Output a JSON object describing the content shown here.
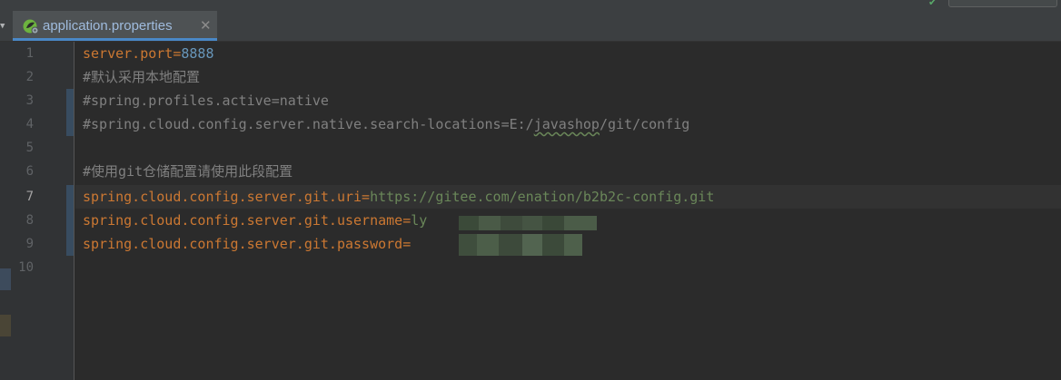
{
  "tab": {
    "label": "application.properties",
    "close_icon": "close-icon",
    "file_icon": "spring-properties-icon"
  },
  "gutter": {
    "line_numbers": [
      "1",
      "2",
      "3",
      "4",
      "5",
      "6",
      "7",
      "8",
      "9",
      "10"
    ],
    "current_line": "7"
  },
  "code": {
    "line1": {
      "key": "server.port",
      "eq": "=",
      "value": "8888"
    },
    "line2": {
      "comment": "#默认采用本地配置"
    },
    "line3": {
      "comment": "#spring.profiles.active=native"
    },
    "line4": {
      "comment_a": "#spring.cloud.config.server.native.search-locations=E:/",
      "comment_b": "javashop",
      "comment_c": "/git/config"
    },
    "line6": {
      "comment": "#使用git仓储配置请使用此段配置"
    },
    "line7": {
      "key": "spring.cloud.config.server.git.uri",
      "eq": "=",
      "value": "https://gitee.com/enation/b2b2c-config.git"
    },
    "line8": {
      "key": "spring.cloud.config.server.git.username",
      "eq": "=",
      "value": "ly"
    },
    "line9": {
      "key": "spring.cloud.config.server.git.password",
      "eq": "=",
      "value": ""
    }
  },
  "colors": {
    "key": "#cc7832",
    "number": "#6897bb",
    "comment": "#808080",
    "string_value": "#6a8759",
    "background": "#2b2b2b"
  }
}
